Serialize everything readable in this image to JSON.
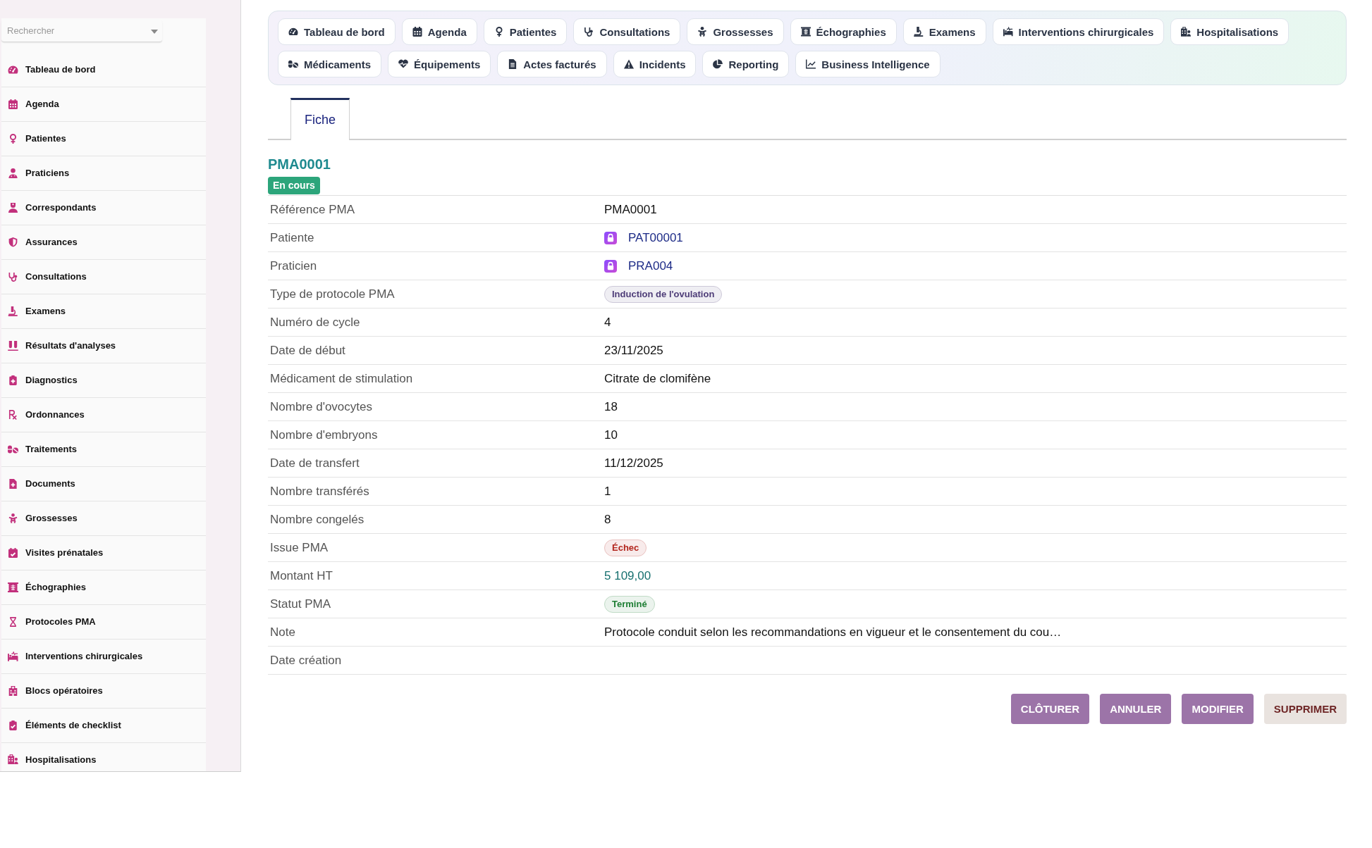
{
  "sidebar": {
    "search": {
      "placeholder": "Rechercher"
    },
    "items": [
      {
        "label": "Tableau de bord"
      },
      {
        "label": "Agenda"
      },
      {
        "label": "Patientes"
      },
      {
        "label": "Praticiens"
      },
      {
        "label": "Correspondants"
      },
      {
        "label": "Assurances"
      },
      {
        "label": "Consultations"
      },
      {
        "label": "Examens"
      },
      {
        "label": "Résultats d'analyses"
      },
      {
        "label": "Diagnostics"
      },
      {
        "label": "Ordonnances"
      },
      {
        "label": "Traitements"
      },
      {
        "label": "Documents"
      },
      {
        "label": "Grossesses"
      },
      {
        "label": "Visites prénatales"
      },
      {
        "label": "Échographies"
      },
      {
        "label": "Protocoles PMA"
      },
      {
        "label": "Interventions chirurgicales"
      },
      {
        "label": "Blocs opératoires"
      },
      {
        "label": "Éléments de checklist"
      },
      {
        "label": "Hospitalisations"
      }
    ]
  },
  "nav": {
    "items": [
      {
        "label": "Tableau de bord"
      },
      {
        "label": "Agenda"
      },
      {
        "label": "Patientes"
      },
      {
        "label": "Consultations"
      },
      {
        "label": "Grossesses"
      },
      {
        "label": "Échographies"
      },
      {
        "label": "Examens"
      },
      {
        "label": "Interventions chirurgicales"
      },
      {
        "label": "Hospitalisations"
      },
      {
        "label": "Médicaments"
      },
      {
        "label": "Équipements"
      },
      {
        "label": "Actes facturés"
      },
      {
        "label": "Incidents"
      },
      {
        "label": "Reporting"
      },
      {
        "label": "Business Intelligence"
      }
    ]
  },
  "record_tabs": [
    {
      "label": "Fiche",
      "selected": true
    }
  ],
  "record": {
    "title": "PMA0001",
    "status": "En cours",
    "fields": [
      {
        "label": "Référence PMA",
        "kind": "text",
        "value": "PMA0001"
      },
      {
        "label": "Patiente",
        "kind": "link",
        "value": "PAT00001"
      },
      {
        "label": "Praticien",
        "kind": "link",
        "value": "PRA004"
      },
      {
        "label": "Type de protocole PMA",
        "kind": "tag",
        "value": "Induction de l'ovulation",
        "color": "#4e3d78"
      },
      {
        "label": "Numéro de cycle",
        "kind": "text",
        "value": "4"
      },
      {
        "label": "Date de début",
        "kind": "text",
        "value": "23/11/2025"
      },
      {
        "label": "Médicament de stimulation",
        "kind": "text",
        "value": "Citrate de clomifène"
      },
      {
        "label": "Nombre d'ovocytes",
        "kind": "text",
        "value": "18"
      },
      {
        "label": "Nombre d'embryons",
        "kind": "text",
        "value": "10"
      },
      {
        "label": "Date de transfert",
        "kind": "text",
        "value": "11/12/2025"
      },
      {
        "label": "Nombre transférés",
        "kind": "text",
        "value": "1"
      },
      {
        "label": "Nombre congelés",
        "kind": "text",
        "value": "8"
      },
      {
        "label": "Issue PMA",
        "kind": "tag",
        "value": "Échec",
        "color": "#b3261e"
      },
      {
        "label": "Montant HT",
        "kind": "amount",
        "value": "5 109,00"
      },
      {
        "label": "Statut PMA",
        "kind": "tag",
        "value": "Terminé",
        "color": "#1e7e34"
      },
      {
        "label": "Note",
        "kind": "text",
        "value": "Protocole conduit selon les recommandations en vigueur et le consentement du cou…"
      },
      {
        "label": "Date création"
      }
    ]
  },
  "actions": [
    {
      "label": "CLÔTURER",
      "kind": "primary"
    },
    {
      "label": "ANNULER",
      "kind": "primary"
    },
    {
      "label": "MODIFIER",
      "kind": "primary"
    },
    {
      "label": "SUPPRIMER",
      "kind": "danger"
    }
  ]
}
